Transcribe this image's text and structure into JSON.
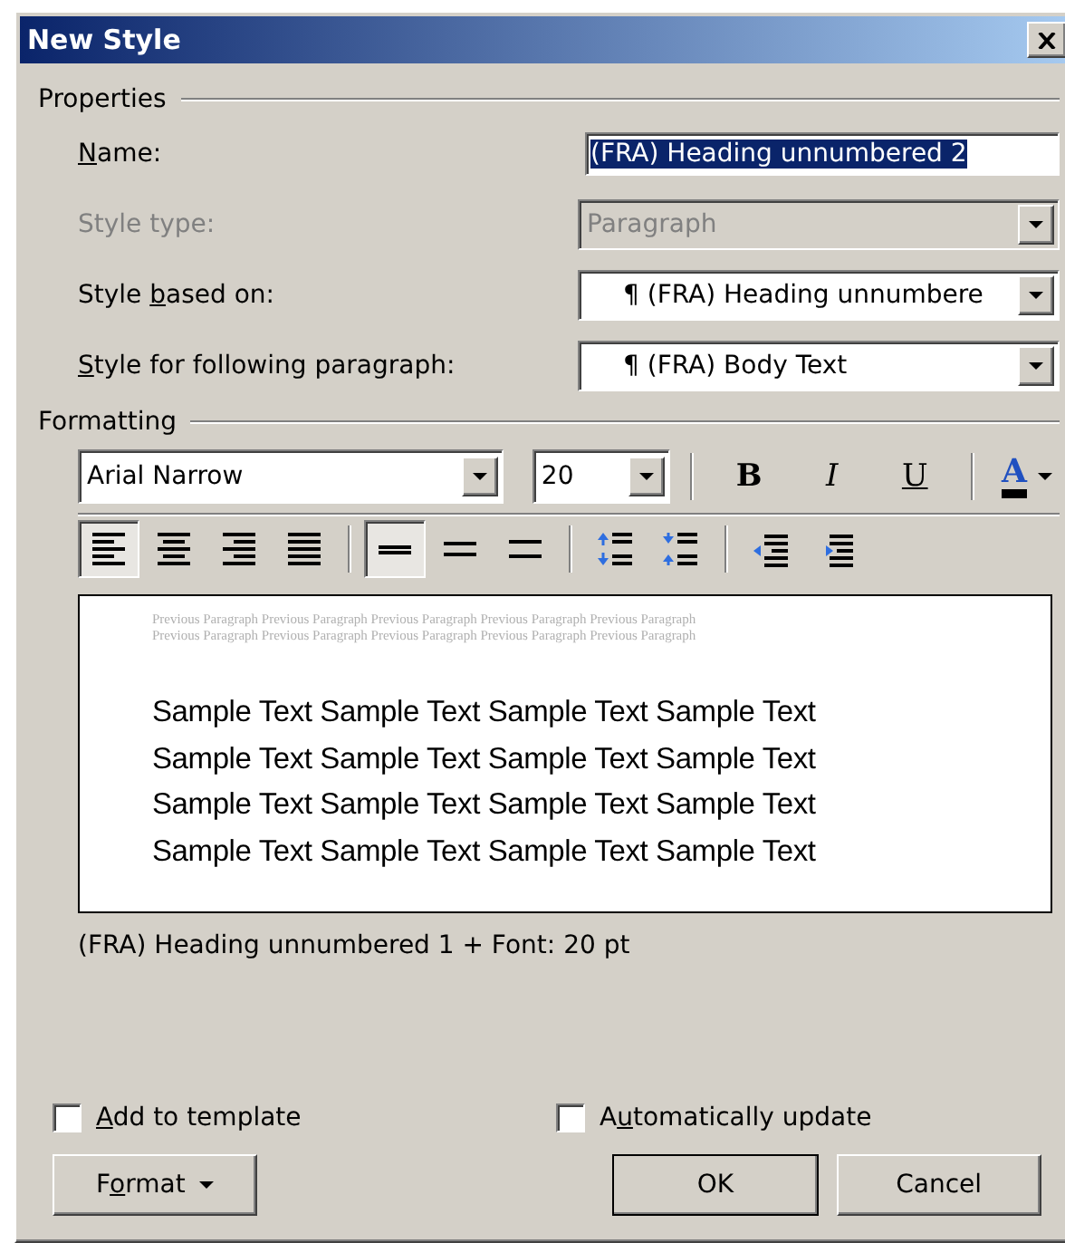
{
  "window": {
    "title": "New Style"
  },
  "properties": {
    "heading": "Properties",
    "fields": [
      {
        "kind": "text",
        "label": {
          "key": "N",
          "after": "ame:"
        },
        "value": "(FRA) Heading unnumbered 2",
        "disabled": false,
        "highlighted": true
      },
      {
        "kind": "combo",
        "label": {
          "before": "Style type:"
        },
        "value": "Paragraph",
        "disabled": true
      },
      {
        "kind": "combo",
        "label": {
          "before": "Style ",
          "key": "b",
          "after": "ased on:"
        },
        "value": "¶ (FRA) Heading unnumbere",
        "disabled": false
      },
      {
        "kind": "combo",
        "label": {
          "key": "S",
          "after": "tyle for following paragraph:"
        },
        "value": "¶ (FRA) Body Text",
        "disabled": false
      }
    ]
  },
  "formatting": {
    "heading": "Formatting",
    "font": "Arial Narrow",
    "size": "20",
    "styles": [
      {
        "kind": "bold",
        "label": "B"
      },
      {
        "kind": "italic",
        "label": "I"
      },
      {
        "kind": "underline",
        "label": "U"
      }
    ],
    "font_color": {
      "label": "A",
      "color": "#000000"
    },
    "paragraph_tools": [
      {
        "kind": "align-left",
        "selected": true
      },
      {
        "kind": "align-center",
        "selected": false
      },
      {
        "kind": "align-right",
        "selected": false
      },
      {
        "kind": "justify",
        "selected": false
      },
      {
        "kind": "sep"
      },
      {
        "kind": "single",
        "selected": true
      },
      {
        "kind": "one-half",
        "selected": false
      },
      {
        "kind": "double",
        "selected": false
      },
      {
        "kind": "sep"
      },
      {
        "kind": "space-before",
        "selected": false
      },
      {
        "kind": "space-after",
        "selected": false
      },
      {
        "kind": "sep"
      },
      {
        "kind": "outdent",
        "selected": false
      },
      {
        "kind": "indent",
        "selected": false
      }
    ]
  },
  "preview": {
    "previous": [
      "Previous Paragraph Previous Paragraph Previous Paragraph Previous Paragraph Previous Paragraph",
      "Previous Paragraph Previous Paragraph Previous Paragraph Previous Paragraph Previous Paragraph"
    ],
    "sample": [
      "Sample Text Sample Text Sample Text Sample Text",
      "Sample Text Sample Text Sample Text Sample Text",
      "Sample Text Sample Text Sample Text Sample Text",
      "Sample Text Sample Text Sample Text Sample Text"
    ]
  },
  "description": "(FRA) Heading unnumbered 1 + Font: 20 pt",
  "checkboxes": [
    {
      "label": {
        "key": "A",
        "after": "dd to template"
      },
      "checked": false
    },
    {
      "label": {
        "before": "A",
        "key": "u",
        "after": "tomatically update"
      },
      "checked": false
    }
  ],
  "buttons": [
    {
      "kind": "menu",
      "label": {
        "before": "F",
        "key": "o",
        "after": "rmat"
      }
    },
    {
      "kind": "default",
      "label": {
        "before": "OK"
      }
    },
    {
      "kind": "plain",
      "label": {
        "before": "Cancel"
      }
    }
  ]
}
